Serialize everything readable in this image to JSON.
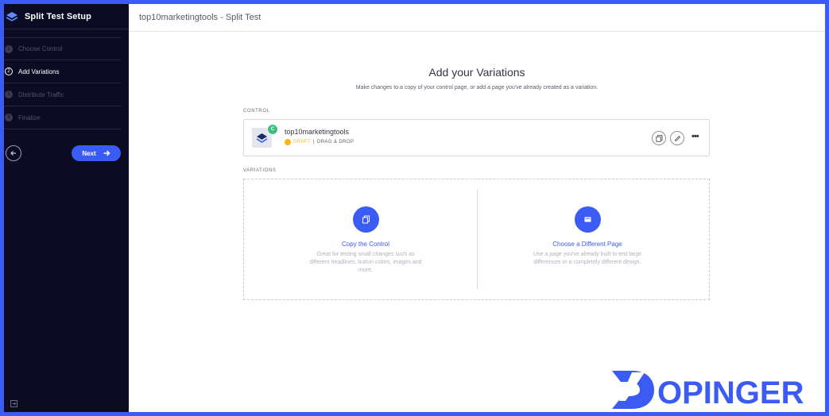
{
  "sidebar": {
    "title": "Split Test Setup",
    "steps": [
      {
        "num": "1",
        "label": "Choose Control"
      },
      {
        "num": "2",
        "label": "Add Variations"
      },
      {
        "num": "3",
        "label": "Distribute Traffic"
      },
      {
        "num": "4",
        "label": "Finalize"
      }
    ],
    "active_step": 2,
    "next_label": "Next"
  },
  "header": {
    "title": "top10marketingtools - Split Test"
  },
  "main": {
    "heading": "Add your Variations",
    "subheading": "Make changes to a copy of your control page, or add a page you've already created as a variation.",
    "control_label": "CONTROL",
    "control": {
      "badge": "C",
      "name": "top10marketingtools",
      "status": "DRAFT",
      "separator": "|",
      "type": "DRAG & DROP",
      "more": "•••"
    },
    "variations_label": "VARIATIONS",
    "options": [
      {
        "title": "Copy the Control",
        "description": "Great for testing small changes such as different headlines, button colors, images and more.",
        "icon": "copy-icon"
      },
      {
        "title": "Choose a Different Page",
        "description": "Use a page you've already built to test large differences or a completely different design.",
        "icon": "page-icon"
      }
    ]
  },
  "watermark": {
    "text": "DOPINGER"
  },
  "colors": {
    "accent": "#3b5bf5",
    "sidebar_bg": "#0b0b24",
    "draft": "#f2b81c",
    "badge": "#3fbf7f"
  }
}
